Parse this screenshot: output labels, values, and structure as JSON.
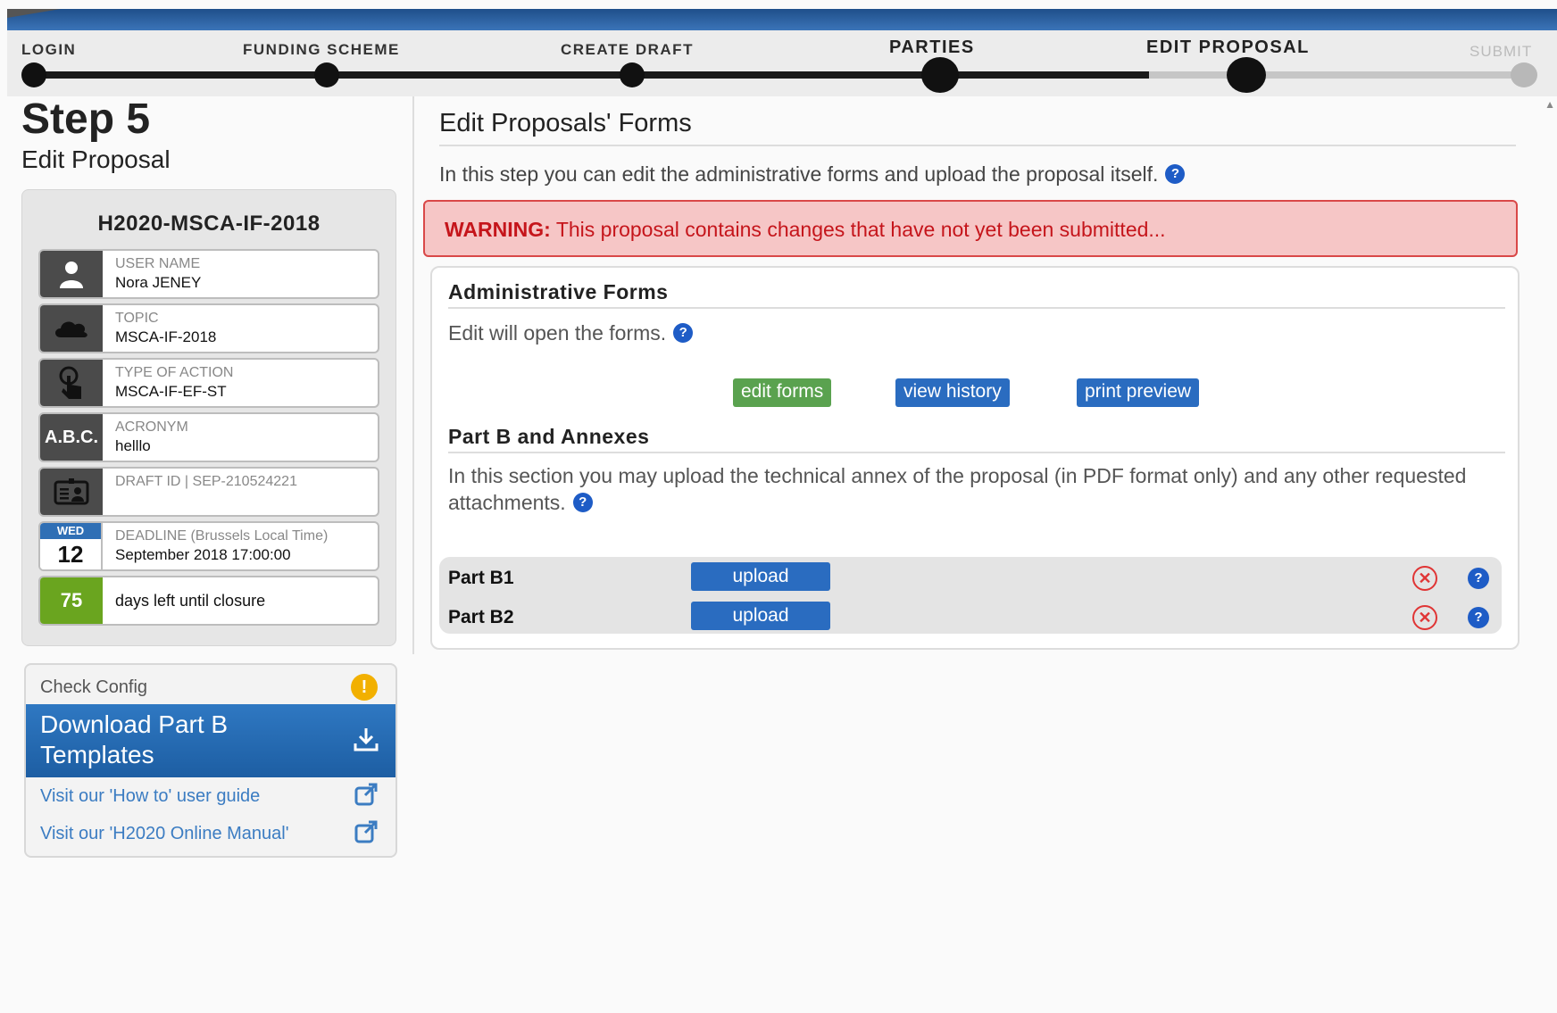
{
  "stepper": {
    "steps": [
      {
        "label": "LOGIN"
      },
      {
        "label": "FUNDING SCHEME"
      },
      {
        "label": "CREATE DRAFT"
      },
      {
        "label": "PARTIES"
      },
      {
        "label": "EDIT PROPOSAL"
      },
      {
        "label": "SUBMIT"
      }
    ],
    "current_step": "EDIT PROPOSAL"
  },
  "sidebar": {
    "step_title": "Step 5",
    "step_subtitle": "Edit Proposal",
    "call_id": "H2020-MSCA-IF-2018",
    "info": {
      "user_name_label": "USER NAME",
      "user_name": "Nora JENEY",
      "topic_label": "TOPIC",
      "topic": "MSCA-IF-2018",
      "action_label": "TYPE OF ACTION",
      "action": "MSCA-IF-EF-ST",
      "acronym_label": "ACRONYM",
      "acronym": "helllo",
      "acronym_icon_text": "A.B.C.",
      "draft_label": "DRAFT ID | SEP-210524221",
      "deadline_label": "DEADLINE (Brussels Local Time)",
      "deadline": "September 2018 17:00:00",
      "deadline_weekday": "WED",
      "deadline_day": "12",
      "days_left": "75",
      "days_left_text": "days left until closure"
    },
    "panel": {
      "check_config": "Check Config",
      "download_label": "Download Part B Templates",
      "link_guide": "Visit our 'How to' user guide",
      "link_manual": "Visit our 'H2020 Online Manual'"
    }
  },
  "main": {
    "title": "Edit Proposals' Forms",
    "intro": "In this step you can edit the administrative forms and upload the proposal itself.",
    "warning_label": "WARNING:",
    "warning_text": "This proposal contains changes that have not yet been submitted...",
    "admin": {
      "title": "Administrative Forms",
      "text": "Edit will open the forms.",
      "edit_btn": "edit forms",
      "history_btn": "view history",
      "preview_btn": "print preview"
    },
    "partb": {
      "title": "Part B and Annexes",
      "text": "In this section you may upload the technical annex of the proposal (in PDF format only) and any other requested attachments.",
      "rows": [
        {
          "name": "Part B1",
          "button": "upload"
        },
        {
          "name": "Part B2",
          "button": "upload"
        }
      ]
    }
  },
  "colors": {
    "accent_blue": "#2a6cc0",
    "green": "#5aa24f",
    "warning_red": "#c5151b",
    "days_green": "#6aa51f"
  }
}
